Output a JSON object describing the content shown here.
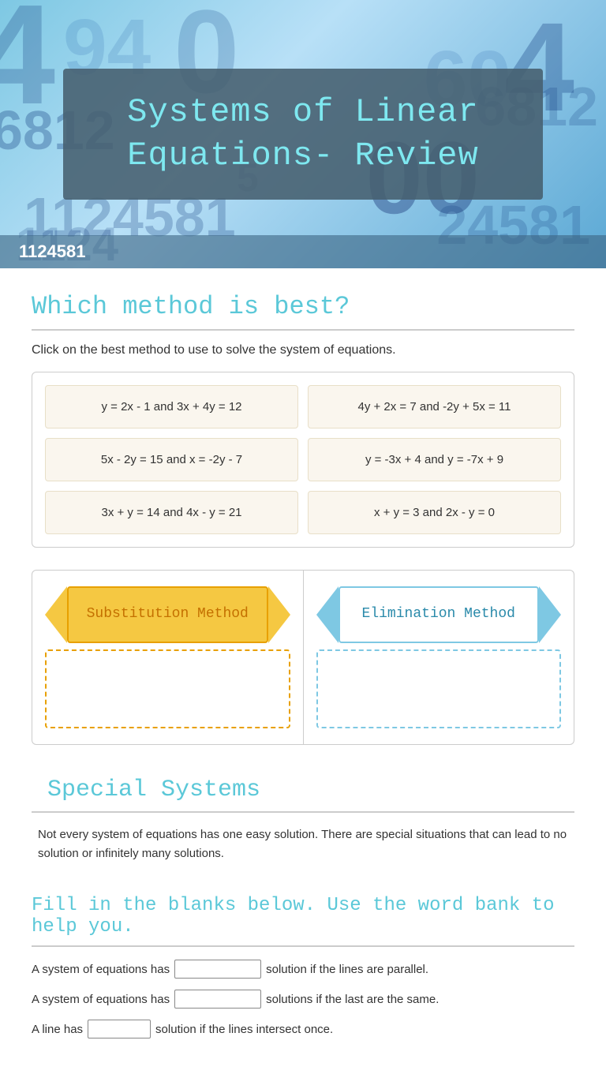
{
  "header": {
    "title": "Systems of Linear Equations- Review",
    "bottom_label": "1124581"
  },
  "which_method": {
    "section_title": "Which method is best?",
    "instruction": "Click on the best method to use to solve the system of equations.",
    "equations": [
      "y = 2x - 1  and   3x + 4y = 12",
      "4y + 2x = 7  and  -2y + 5x = 11",
      "5x - 2y = 15  and x = -2y - 7",
      "y = -3x + 4 and y = -7x + 9",
      "3x + y = 14  and  4x - y = 21",
      "x + y = 3  and  2x - y = 0"
    ]
  },
  "methods": {
    "substitution": {
      "label": "Substitution Method"
    },
    "elimination": {
      "label": "Elimination Method"
    }
  },
  "special_systems": {
    "section_title": "Special Systems",
    "text": "Not every system of equations has one easy solution.  There are special situations that can lead to no solution or infinitely many solutions."
  },
  "fill_blanks": {
    "section_title": "Fill in the blanks below. Use the word bank to help you.",
    "lines": [
      {
        "before": "A system of equations has",
        "blank_size": "normal",
        "after": "solution if the lines are parallel."
      },
      {
        "before": "A system of equations has",
        "blank_size": "normal",
        "after": "solutions if the last are the same."
      },
      {
        "before": "A line has",
        "blank_size": "small",
        "after": "solution if the lines intersect once."
      }
    ]
  }
}
